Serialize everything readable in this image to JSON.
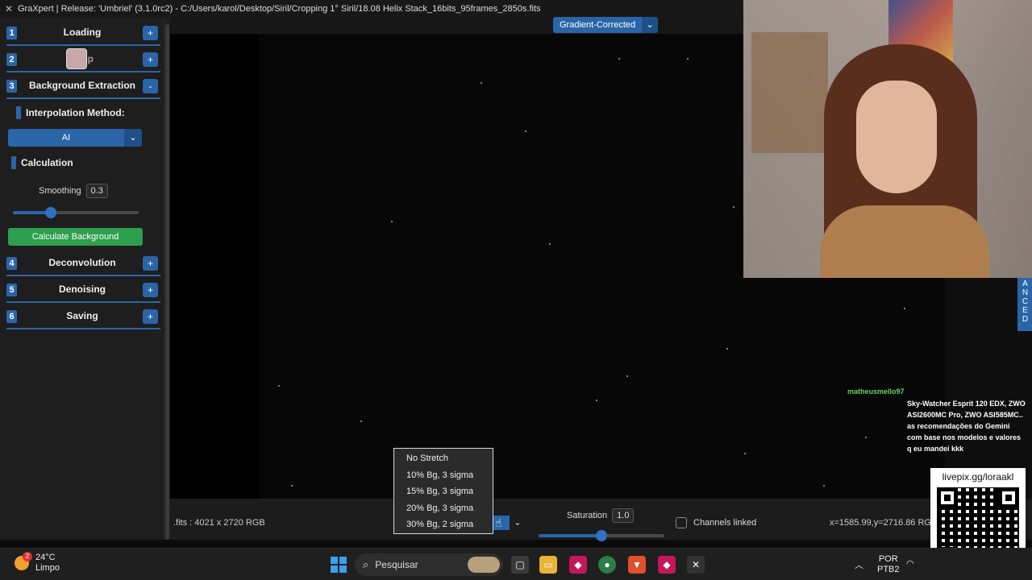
{
  "window": {
    "title": "GraXpert | Release: 'Umbriel' (3.1.0rc2) - C:/Users/karol/Desktop/Siril/Cropping 1° Siril/18.08 Helix Stack_16bits_95frames_2850s.fits"
  },
  "sidebar": {
    "sections": [
      {
        "num": "1",
        "title": "Loading",
        "toggle": "+"
      },
      {
        "num": "2",
        "title": "Crop",
        "toggle": "+"
      },
      {
        "num": "3",
        "title": "Background Extraction",
        "toggle": "-"
      },
      {
        "num": "4",
        "title": "Deconvolution",
        "toggle": "+"
      },
      {
        "num": "5",
        "title": "Denoising",
        "toggle": "+"
      },
      {
        "num": "6",
        "title": "Saving",
        "toggle": "+"
      }
    ],
    "interpolation_label": "Interpolation Method:",
    "interpolation_value": "AI",
    "calculation_label": "Calculation",
    "smoothing_label": "Smoothing",
    "smoothing_value": "0.3",
    "smoothing_level": 0.3,
    "calculate_button": "Calculate Background"
  },
  "viewer": {
    "view_mode": "Gradient-Corrected",
    "side_tab": "ANCED"
  },
  "status": {
    "image_info": ".fits : 4021 x 2720 RGB",
    "saturation_label": "Saturation",
    "saturation_value": "1.0",
    "saturation_level": 0.5,
    "channels_linked_label": "Channels linked",
    "coords": "x=1585.99,y=2716.86  RGB"
  },
  "stretch_menu": {
    "options": [
      "No Stretch",
      "10% Bg, 3 sigma",
      "15% Bg, 3 sigma",
      "20% Bg, 3 sigma",
      "30% Bg, 2 sigma"
    ]
  },
  "chat": {
    "user": "matheusmello97",
    "message": "Sky-Watcher Esprit 120 EDX, ZWO ASI2600MC Pro, ZWO ASI585MC.. as recomendações do Gemini com base nos modelos e valores q eu mandei kkk"
  },
  "qr": {
    "url": "livepix.gg/loraakl"
  },
  "taskbar": {
    "weather_temp": "24°C",
    "weather_desc": "Limpo",
    "weather_badge": "2",
    "search_placeholder": "Pesquisar",
    "lang_top": "POR",
    "lang_bottom": "PTB2"
  }
}
